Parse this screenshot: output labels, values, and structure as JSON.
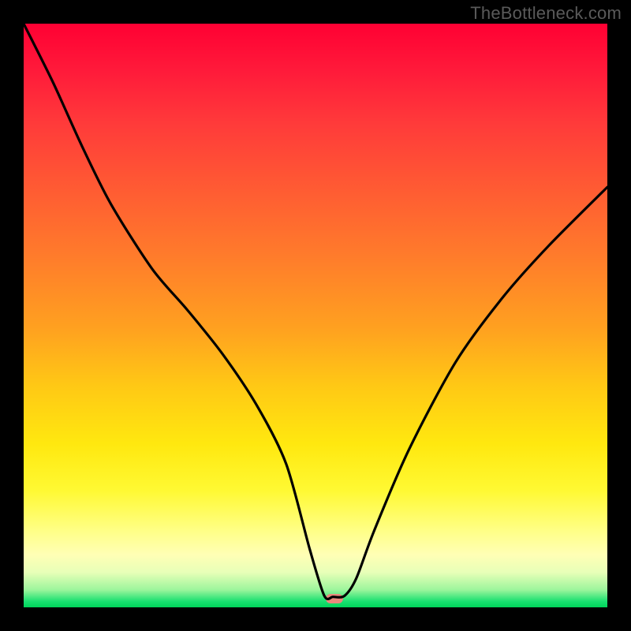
{
  "watermark": "TheBottleneck.com",
  "marker": {
    "x_frac": 0.532,
    "y_frac": 0.985,
    "color": "#e88a7d"
  },
  "chart_data": {
    "type": "line",
    "title": "",
    "xlabel": "",
    "ylabel": "",
    "xlim": [
      0,
      1
    ],
    "ylim": [
      0,
      1
    ],
    "x": [
      0.0,
      0.05,
      0.1,
      0.15,
      0.22,
      0.28,
      0.34,
      0.4,
      0.45,
      0.49,
      0.515,
      0.53,
      0.55,
      0.57,
      0.6,
      0.66,
      0.74,
      0.82,
      0.9,
      1.0
    ],
    "values": [
      1.0,
      0.9,
      0.79,
      0.69,
      0.58,
      0.51,
      0.435,
      0.345,
      0.245,
      0.1,
      0.02,
      0.018,
      0.02,
      0.05,
      0.13,
      0.27,
      0.42,
      0.53,
      0.62,
      0.72
    ],
    "marker_point": {
      "x": 0.532,
      "y": 0.018
    },
    "background_gradient": {
      "orientation": "vertical",
      "stops": [
        {
          "pos": 0.0,
          "color": "#ff0033"
        },
        {
          "pos": 0.5,
          "color": "#ff9a22"
        },
        {
          "pos": 0.8,
          "color": "#fff933"
        },
        {
          "pos": 0.95,
          "color": "#d8ffb0"
        },
        {
          "pos": 1.0,
          "color": "#00d45a"
        }
      ]
    }
  }
}
